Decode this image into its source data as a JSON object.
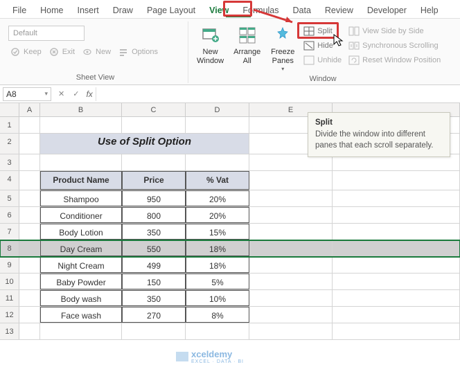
{
  "tabs": [
    "File",
    "Home",
    "Insert",
    "Draw",
    "Page Layout",
    "View",
    "Formulas",
    "Data",
    "Review",
    "Developer",
    "Help"
  ],
  "active_tab": "View",
  "ribbon": {
    "sheet_view": {
      "dropdown": "Default",
      "keep": "Keep",
      "exit": "Exit",
      "new": "New",
      "options": "Options",
      "group_label": "Sheet View"
    },
    "window": {
      "new_window": "New\nWindow",
      "arrange_all": "Arrange\nAll",
      "freeze_panes": "Freeze\nPanes",
      "split": "Split",
      "hide": "Hide",
      "unhide": "Unhide",
      "view_side_by_side": "View Side by Side",
      "synchronous_scrolling": "Synchronous Scrolling",
      "reset_window_position": "Reset Window Position",
      "group_label": "Window"
    }
  },
  "namebox": "A8",
  "fx": "fx",
  "tooltip": {
    "title": "Split",
    "body": "Divide the window into different panes that each scroll separately."
  },
  "sheet": {
    "title": "Use of Split Option",
    "headers": [
      "Product Name",
      "Price",
      "% Vat"
    ],
    "rows": [
      {
        "name": "Shampoo",
        "price": "950",
        "vat": "20%"
      },
      {
        "name": "Conditioner",
        "price": "800",
        "vat": "20%"
      },
      {
        "name": "Body Lotion",
        "price": "350",
        "vat": "15%"
      },
      {
        "name": "Day Cream",
        "price": "550",
        "vat": "18%"
      },
      {
        "name": "Night Cream",
        "price": "499",
        "vat": "18%"
      },
      {
        "name": "Baby Powder",
        "price": "150",
        "vat": "5%"
      },
      {
        "name": "Body wash",
        "price": "350",
        "vat": "10%"
      },
      {
        "name": "Face wash",
        "price": "270",
        "vat": "8%"
      }
    ],
    "selected_row": 8
  },
  "columns": [
    "A",
    "B",
    "C",
    "D",
    "E"
  ],
  "watermark": {
    "brand": "xceldemy",
    "sub": "EXCEL · DATA · BI"
  }
}
